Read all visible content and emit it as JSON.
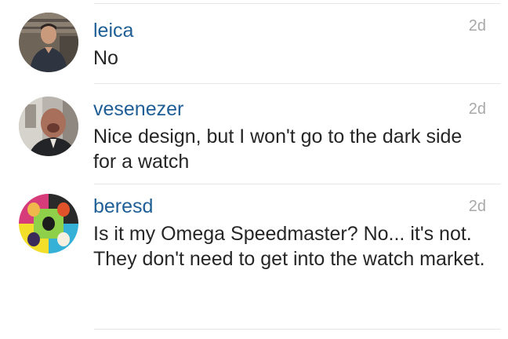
{
  "comments": [
    {
      "username": "leica",
      "time": "2d",
      "text": "No",
      "avatar": "avatar-man-dark-shirt"
    },
    {
      "username": "vesenezer",
      "time": "2d",
      "text": "Nice design, but I won't go to the dark side for a watch",
      "avatar": "avatar-man-blurred-office"
    },
    {
      "username": "beresd",
      "time": "2d",
      "text": "Is it my Omega Speedmaster? No... it's not. They don't need to get into the watch market.",
      "avatar": "avatar-pop-art-grid"
    }
  ],
  "colors": {
    "username": "#1f5f95",
    "timestamp": "#a8a8a8",
    "text": "#262626",
    "divider": "#e6e6e6"
  }
}
